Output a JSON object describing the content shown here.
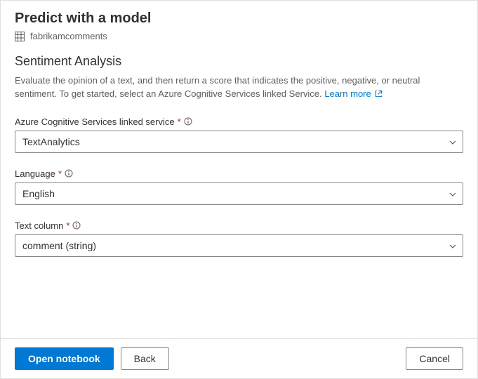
{
  "header": {
    "title": "Predict with a model",
    "dataset": "fabrikamcomments"
  },
  "section": {
    "title": "Sentiment Analysis",
    "description": "Evaluate the opinion of a text, and then return a score that indicates the positive, negative, or neutral sentiment. To get started, select an Azure Cognitive Services linked Service. ",
    "learn_more": "Learn more"
  },
  "fields": {
    "linked_service": {
      "label": "Azure Cognitive Services linked service",
      "value": "TextAnalytics"
    },
    "language": {
      "label": "Language",
      "value": "English"
    },
    "text_column": {
      "label": "Text column",
      "value": "comment (string)"
    }
  },
  "footer": {
    "open_notebook": "Open notebook",
    "back": "Back",
    "cancel": "Cancel"
  }
}
